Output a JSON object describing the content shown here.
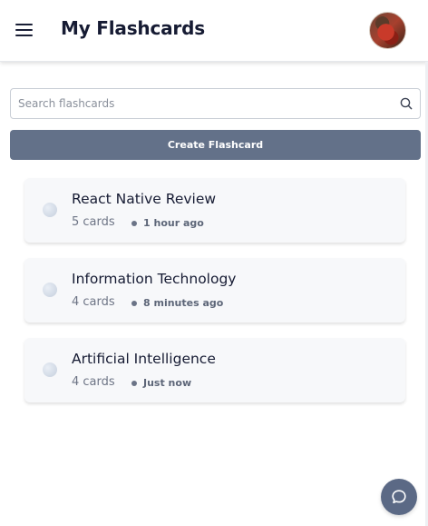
{
  "header": {
    "title": "My Flashcards",
    "menu_icon": "hamburger-menu-icon",
    "avatar": "user-avatar"
  },
  "search": {
    "placeholder": "Search flashcards",
    "value": "",
    "icon": "search-icon"
  },
  "actions": {
    "create_label": "Create Flashcard"
  },
  "decks": [
    {
      "title": "React Native Review",
      "count": "5 cards",
      "time": "1 hour ago"
    },
    {
      "title": "Information Technology",
      "count": "4 cards",
      "time": "8 minutes ago"
    },
    {
      "title": "Artificial Intelligence",
      "count": "4 cards",
      "time": "Just now"
    }
  ],
  "chat": {
    "icon": "chat-bubble-icon"
  },
  "colors": {
    "primary_button": "#637189",
    "title_text": "#161b33",
    "card_background": "#f7f8fa",
    "chat_fab": "#5b6985"
  }
}
